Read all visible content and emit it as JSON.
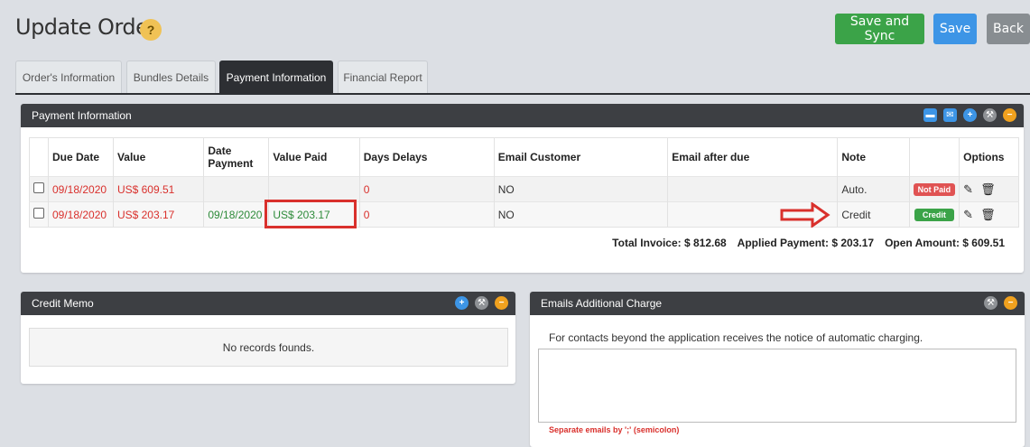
{
  "header": {
    "title": "Update Order",
    "help_glyph": "?",
    "buttons": {
      "save_sync": "Save and Sync",
      "save": "Save",
      "back": "Back"
    }
  },
  "tabs": [
    {
      "label": "Order's Information"
    },
    {
      "label": "Bundles Details"
    },
    {
      "label": "Payment Information"
    },
    {
      "label": "Financial Report"
    }
  ],
  "payment": {
    "title": "Payment Information",
    "columns": [
      "Due Date",
      "Value",
      "Date Payment",
      "Value Paid",
      "Days Delays",
      "Email Customer",
      "Email after due",
      "Note",
      "",
      "Options"
    ],
    "rows": [
      {
        "due_date": "09/18/2020",
        "value": "US$ 609.51",
        "date_payment": "",
        "value_paid": "",
        "days_delays": "0",
        "email_customer": "NO",
        "email_after_due": "",
        "note": "Auto.",
        "status": "Not Paid"
      },
      {
        "due_date": "09/18/2020",
        "value": "US$ 203.17",
        "date_payment": "09/18/2020",
        "value_paid": "US$ 203.17",
        "days_delays": "0",
        "email_customer": "NO",
        "email_after_due": "",
        "note": "Credit",
        "status": "Credit"
      }
    ],
    "totals": {
      "invoice": "Total Invoice: $ 812.68",
      "applied": "Applied Payment: $ 203.17",
      "open": "Open Amount: $ 609.51"
    }
  },
  "credit_memo": {
    "title": "Credit Memo",
    "empty": "No records founds."
  },
  "emails_charge": {
    "title": "Emails Additional Charge",
    "note": "For contacts beyond the application receives the notice of automatic charging.",
    "hint": "Separate emails by ';' (semicolon)"
  },
  "colors": {
    "accent_green": "#3ba348",
    "accent_blue": "#3d95e6",
    "alert_red": "#d9302c",
    "panel_head": "#3d3f43"
  },
  "icons": [
    "card-icon",
    "email-icon",
    "plus-icon",
    "wrench-icon",
    "minus-icon",
    "pencil-icon",
    "trash-icon",
    "arrow-right-icon"
  ]
}
